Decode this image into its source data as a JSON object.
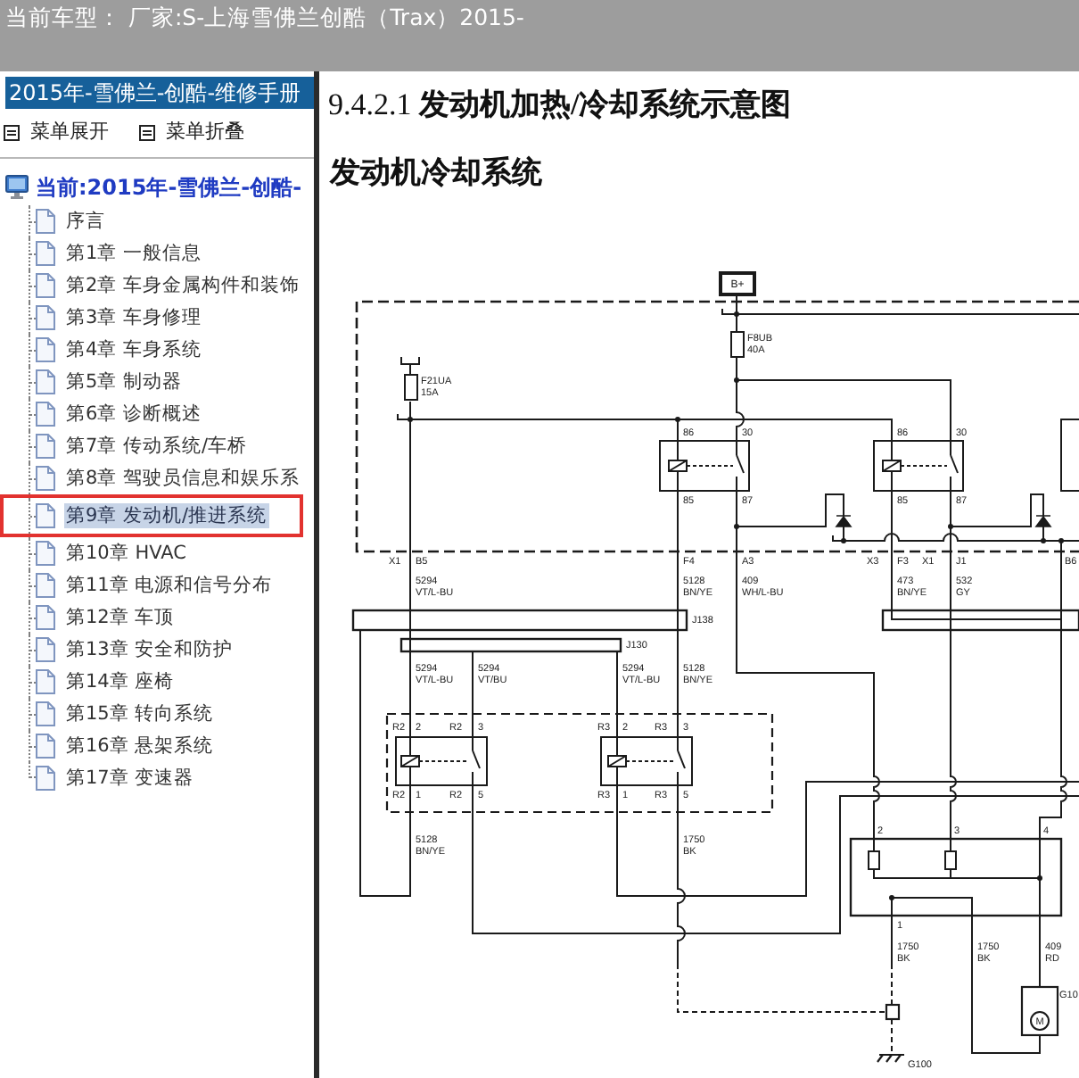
{
  "top_bar": {
    "title": "当前车型： 厂家:S-上海雪佛兰创酷（Trax）2015-"
  },
  "sidebar": {
    "header": "2015年-雪佛兰-创酷-维修手册",
    "actions": [
      {
        "label": "菜单展开"
      },
      {
        "label": "菜单折叠"
      }
    ],
    "tree": {
      "label": "当前:2015年-雪佛兰-创酷-",
      "children": [
        {
          "label": "序言",
          "selected": false,
          "circled": false
        },
        {
          "label": "第1章 一般信息",
          "selected": false,
          "circled": false
        },
        {
          "label": "第2章 车身金属构件和装饰",
          "selected": false,
          "circled": false
        },
        {
          "label": "第3章 车身修理",
          "selected": false,
          "circled": false
        },
        {
          "label": "第4章 车身系统",
          "selected": false,
          "circled": false
        },
        {
          "label": "第5章 制动器",
          "selected": false,
          "circled": false
        },
        {
          "label": "第6章 诊断概述",
          "selected": false,
          "circled": false
        },
        {
          "label": "第7章 传动系统/车桥",
          "selected": false,
          "circled": false
        },
        {
          "label": "第8章 驾驶员信息和娱乐系",
          "selected": false,
          "circled": false
        },
        {
          "label": "第9章 发动机/推进系统",
          "selected": true,
          "circled": true
        },
        {
          "label": "第10章 HVAC",
          "selected": false,
          "circled": false
        },
        {
          "label": "第11章 电源和信号分布",
          "selected": false,
          "circled": false
        },
        {
          "label": "第12章 车顶",
          "selected": false,
          "circled": false
        },
        {
          "label": "第13章 安全和防护",
          "selected": false,
          "circled": false
        },
        {
          "label": "第14章 座椅",
          "selected": false,
          "circled": false
        },
        {
          "label": "第15章 转向系统",
          "selected": false,
          "circled": false
        },
        {
          "label": "第16章 悬架系统",
          "selected": false,
          "circled": false
        },
        {
          "label": "第17章 变速器",
          "selected": false,
          "circled": false
        }
      ]
    }
  },
  "content": {
    "heading": "9.4.2.1 **发动机加热/冷却系统示意图**",
    "subheading": "发动机冷却系统",
    "schematic": {
      "labels": [
        {
          "kind": "terminal",
          "text": "B+"
        },
        {
          "kind": "fuse",
          "name": "F8UB",
          "rating": "40A"
        },
        {
          "kind": "fuse",
          "name": "F21UA",
          "rating": "15A"
        },
        {
          "kind": "pin",
          "text": "86"
        },
        {
          "kind": "pin",
          "text": "30"
        },
        {
          "kind": "pin",
          "text": "86"
        },
        {
          "kind": "pin",
          "text": "30"
        },
        {
          "kind": "pin",
          "text": "85"
        },
        {
          "kind": "pin",
          "text": "87"
        },
        {
          "kind": "pin",
          "text": "85"
        },
        {
          "kind": "pin",
          "text": "87"
        },
        {
          "kind": "pin",
          "text": "X1"
        },
        {
          "kind": "pin",
          "text": "B5"
        },
        {
          "kind": "pin",
          "text": "F4"
        },
        {
          "kind": "pin",
          "text": "A3"
        },
        {
          "kind": "pin",
          "text": "X3"
        },
        {
          "kind": "pin",
          "text": "F3"
        },
        {
          "kind": "pin",
          "text": "X1"
        },
        {
          "kind": "pin",
          "text": "J1"
        },
        {
          "kind": "pin",
          "text": "B6"
        },
        {
          "kind": "wire",
          "number": "5294",
          "code": "VT/L-BU"
        },
        {
          "kind": "wire",
          "number": "5128",
          "code": "BN/YE"
        },
        {
          "kind": "wire",
          "number": "409",
          "code": "WH/L-BU"
        },
        {
          "kind": "wire",
          "number": "473",
          "code": "BN/YE"
        },
        {
          "kind": "wire",
          "number": "532",
          "code": "GY"
        },
        {
          "kind": "splice",
          "text": "J138"
        },
        {
          "kind": "splice",
          "text": "J130"
        },
        {
          "kind": "wire",
          "number": "5294",
          "code": "VT/L-BU"
        },
        {
          "kind": "wire",
          "number": "5294",
          "code": "VT/BU"
        },
        {
          "kind": "wire",
          "number": "5294",
          "code": "VT/L-BU"
        },
        {
          "kind": "wire",
          "number": "5128",
          "code": "BN/YE"
        },
        {
          "kind": "pin",
          "text": "R2"
        },
        {
          "kind": "pin",
          "text": "2"
        },
        {
          "kind": "pin",
          "text": "R2"
        },
        {
          "kind": "pin",
          "text": "3"
        },
        {
          "kind": "pin",
          "text": "R3"
        },
        {
          "kind": "pin",
          "text": "2"
        },
        {
          "kind": "pin",
          "text": "R3"
        },
        {
          "kind": "pin",
          "text": "3"
        },
        {
          "kind": "pin",
          "text": "R2"
        },
        {
          "kind": "pin",
          "text": "1"
        },
        {
          "kind": "pin",
          "text": "R2"
        },
        {
          "kind": "pin",
          "text": "5"
        },
        {
          "kind": "pin",
          "text": "R3"
        },
        {
          "kind": "pin",
          "text": "1"
        },
        {
          "kind": "pin",
          "text": "R3"
        },
        {
          "kind": "pin",
          "text": "5"
        },
        {
          "kind": "pin",
          "text": "2"
        },
        {
          "kind": "pin",
          "text": "3"
        },
        {
          "kind": "pin",
          "text": "4"
        },
        {
          "kind": "wire",
          "number": "5128",
          "code": "BN/YE"
        },
        {
          "kind": "wire",
          "number": "1750",
          "code": "BK"
        },
        {
          "kind": "pin",
          "text": "1"
        },
        {
          "kind": "wire",
          "number": "1750",
          "code": "BK"
        },
        {
          "kind": "wire",
          "number": "1750",
          "code": "BK"
        },
        {
          "kind": "wire",
          "number": "409",
          "code": "RD"
        },
        {
          "kind": "device",
          "text": "G10"
        },
        {
          "kind": "motor",
          "text": "M"
        },
        {
          "kind": "ground",
          "text": "G100"
        }
      ]
    }
  }
}
